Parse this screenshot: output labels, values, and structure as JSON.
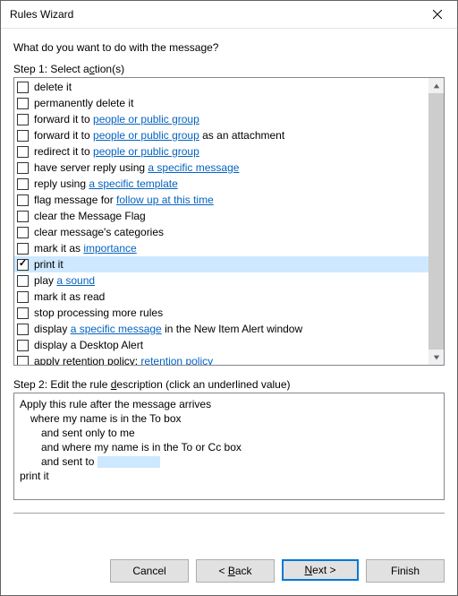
{
  "window": {
    "title": "Rules Wizard"
  },
  "question": "What do you want to do with the message?",
  "step1_label_pre": "Step 1: Select a",
  "step1_label_accel": "c",
  "step1_label_post": "tion(s)",
  "actions": [
    {
      "checked": false,
      "selected": false,
      "parts": [
        {
          "t": "delete it"
        }
      ]
    },
    {
      "checked": false,
      "selected": false,
      "parts": [
        {
          "t": "permanently delete it"
        }
      ]
    },
    {
      "checked": false,
      "selected": false,
      "parts": [
        {
          "t": "forward it to "
        },
        {
          "t": "people or public group",
          "link": true
        }
      ]
    },
    {
      "checked": false,
      "selected": false,
      "parts": [
        {
          "t": "forward it to "
        },
        {
          "t": "people or public group",
          "link": true
        },
        {
          "t": " as an attachment"
        }
      ]
    },
    {
      "checked": false,
      "selected": false,
      "parts": [
        {
          "t": "redirect it to "
        },
        {
          "t": "people or public group",
          "link": true
        }
      ]
    },
    {
      "checked": false,
      "selected": false,
      "parts": [
        {
          "t": "have server reply using "
        },
        {
          "t": "a specific message",
          "link": true
        }
      ]
    },
    {
      "checked": false,
      "selected": false,
      "parts": [
        {
          "t": "reply using "
        },
        {
          "t": "a specific template",
          "link": true
        }
      ]
    },
    {
      "checked": false,
      "selected": false,
      "parts": [
        {
          "t": "flag message for "
        },
        {
          "t": "follow up at this time",
          "link": true
        }
      ]
    },
    {
      "checked": false,
      "selected": false,
      "parts": [
        {
          "t": "clear the Message Flag"
        }
      ]
    },
    {
      "checked": false,
      "selected": false,
      "parts": [
        {
          "t": "clear message's categories"
        }
      ]
    },
    {
      "checked": false,
      "selected": false,
      "parts": [
        {
          "t": "mark it as "
        },
        {
          "t": "importance",
          "link": true
        }
      ]
    },
    {
      "checked": true,
      "selected": true,
      "parts": [
        {
          "t": "print it"
        }
      ]
    },
    {
      "checked": false,
      "selected": false,
      "parts": [
        {
          "t": "play "
        },
        {
          "t": "a sound",
          "link": true
        }
      ]
    },
    {
      "checked": false,
      "selected": false,
      "parts": [
        {
          "t": "mark it as read"
        }
      ]
    },
    {
      "checked": false,
      "selected": false,
      "parts": [
        {
          "t": "stop processing more rules"
        }
      ]
    },
    {
      "checked": false,
      "selected": false,
      "parts": [
        {
          "t": "display "
        },
        {
          "t": "a specific message",
          "link": true
        },
        {
          "t": " in the New Item Alert window"
        }
      ]
    },
    {
      "checked": false,
      "selected": false,
      "parts": [
        {
          "t": "display a Desktop Alert"
        }
      ]
    },
    {
      "checked": false,
      "selected": false,
      "parts": [
        {
          "t": "apply retention policy: "
        },
        {
          "t": "retention policy",
          "link": true
        }
      ]
    }
  ],
  "step2_label_pre": "Step 2: Edit the rule ",
  "step2_label_accel": "d",
  "step2_label_post": "escription (click an underlined value)",
  "description": {
    "line1": "Apply this rule after the message arrives",
    "line2": "where my name is in the To box",
    "line3": "and sent only to me",
    "line4": "and where my name is in the To or Cc box",
    "line5_pre": "and sent to ",
    "line6": "print it"
  },
  "buttons": {
    "cancel": "Cancel",
    "back_accel": "B",
    "back_post": "ack",
    "next_pre": "",
    "next_accel": "N",
    "next_post": "ext >",
    "finish": "Finish"
  }
}
